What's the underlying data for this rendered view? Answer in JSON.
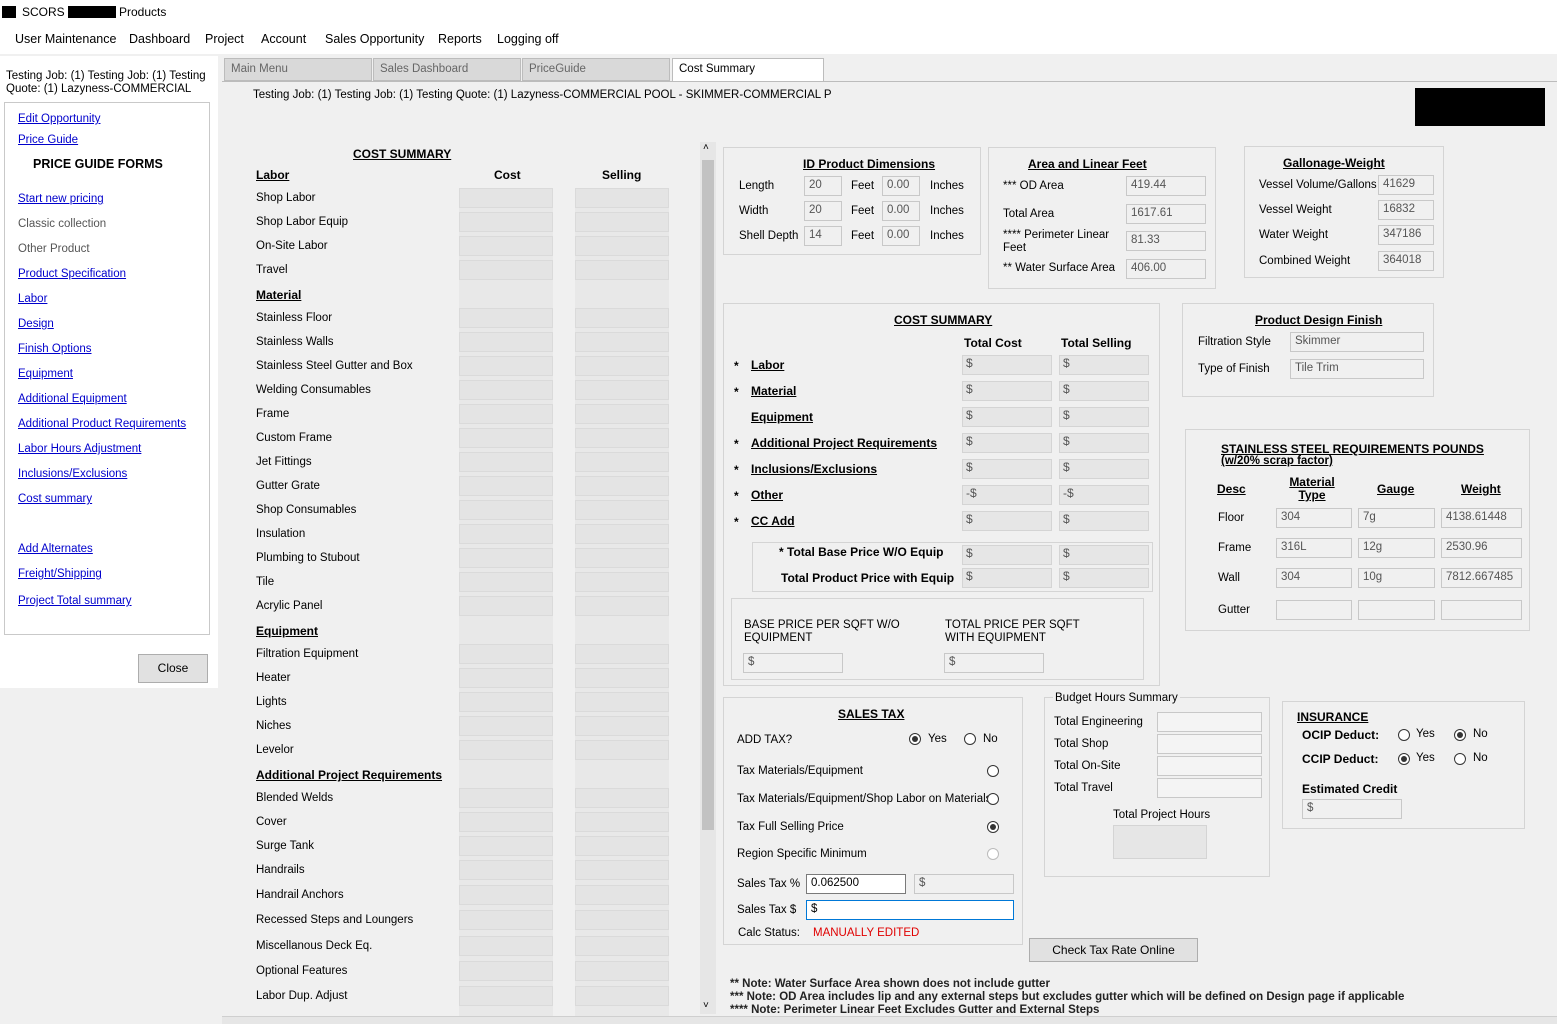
{
  "window": {
    "title_prefix": "SCORS -",
    "title_suffix": "Products"
  },
  "menu": [
    "User Maintenance",
    "Dashboard",
    "Project",
    "Account",
    "Sales Opportunity",
    "Reports",
    "Logging off"
  ],
  "sidebar": {
    "job_info": "Testing Job: (1) Testing Job: (1) Testing Quote: (1) Lazyness-COMMERCIAL",
    "links_top": [
      "Edit Opportunity",
      "Price Guide"
    ],
    "section_title": "PRICE GUIDE FORMS",
    "items": [
      {
        "label": "Start new pricing",
        "link": true
      },
      {
        "label": "Classic collection",
        "link": false
      },
      {
        "label": "Other Product",
        "link": false
      },
      {
        "label": "Product Specification",
        "link": true
      },
      {
        "label": "Labor",
        "link": true
      },
      {
        "label": "Design",
        "link": true
      },
      {
        "label": "Finish Options",
        "link": true
      },
      {
        "label": "Equipment",
        "link": true
      },
      {
        "label": "Additional Equipment",
        "link": true
      },
      {
        "label": "Additional Product Requirements",
        "link": true
      },
      {
        "label": "Labor Hours Adjustment",
        "link": true
      },
      {
        "label": "Inclusions/Exclusions",
        "link": true
      },
      {
        "label": "Cost summary",
        "link": true
      }
    ],
    "items_bottom": [
      "Add Alternates",
      "Freight/Shipping",
      "Project Total summary"
    ],
    "close_label": "Close"
  },
  "tabs": [
    "Main Menu",
    "Sales Dashboard",
    "PriceGuide",
    "Cost Summary"
  ],
  "page_title": "Testing Job: (1) Testing Job: (1) Testing Quote: (1) Lazyness-COMMERCIAL POOL - SKIMMER-COMMERCIAL P",
  "cost_summary": {
    "title": "COST SUMMARY",
    "col_cost": "Cost",
    "col_selling": "Selling",
    "rows": [
      {
        "label": "Labor",
        "header": true
      },
      {
        "label": "Shop Labor"
      },
      {
        "label": "Shop Labor Equip"
      },
      {
        "label": "On-Site Labor"
      },
      {
        "label": "Travel"
      },
      {
        "label": "Material",
        "header": true
      },
      {
        "label": "Stainless Floor"
      },
      {
        "label": "Stainless Walls"
      },
      {
        "label": "Stainless Steel Gutter and Box"
      },
      {
        "label": "Welding Consumables"
      },
      {
        "label": "Frame"
      },
      {
        "label": "Custom Frame"
      },
      {
        "label": "Jet Fittings"
      },
      {
        "label": "Gutter Grate"
      },
      {
        "label": "Shop Consumables"
      },
      {
        "label": "Insulation"
      },
      {
        "label": "Plumbing to Stubout"
      },
      {
        "label": "Tile"
      },
      {
        "label": "Acrylic Panel"
      },
      {
        "label": "Equipment",
        "header": true
      },
      {
        "label": "Filtration Equipment"
      },
      {
        "label": "Heater"
      },
      {
        "label": "Lights"
      },
      {
        "label": "Niches"
      },
      {
        "label": "Levelor"
      },
      {
        "label": "Additional Project Requirements",
        "header": true
      },
      {
        "label": "Blended Welds"
      },
      {
        "label": "Cover"
      },
      {
        "label": "Surge Tank"
      },
      {
        "label": "Handrails"
      },
      {
        "label": "Handrail Anchors"
      },
      {
        "label": "Recessed Steps and Loungers"
      },
      {
        "label": "Miscellanous Deck Eq."
      },
      {
        "label": "Optional Features"
      },
      {
        "label": "Labor Dup. Adjust"
      }
    ]
  },
  "dimensions": {
    "title": "ID Product Dimensions",
    "rows": [
      {
        "label": "Length",
        "feet": "20",
        "feet_unit": "Feet",
        "inches": "0.00",
        "inches_unit": "Inches"
      },
      {
        "label": "Width",
        "feet": "20",
        "feet_unit": "Feet",
        "inches": "0.00",
        "inches_unit": "Inches"
      },
      {
        "label": "Shell Depth",
        "feet": "14",
        "feet_unit": "Feet",
        "inches": "0.00",
        "inches_unit": "Inches"
      }
    ]
  },
  "area": {
    "title": "Area and Linear Feet",
    "od_label": "*** OD Area",
    "od": "419.44",
    "total_label": "Total Area",
    "total": "1617.61",
    "perim_label": "**** Perimeter Linear Feet",
    "perim": "81.33",
    "water_label": "** Water Surface Area",
    "water": "406.00"
  },
  "gallonage": {
    "title": "Gallonage-Weight",
    "rows": [
      {
        "label": "Vessel Volume/Gallons",
        "value": "41629"
      },
      {
        "label": "Vessel Weight",
        "value": "16832"
      },
      {
        "label": "Water Weight",
        "value": "347186"
      },
      {
        "label": "Combined Weight",
        "value": "364018"
      }
    ]
  },
  "totals": {
    "title": "COST SUMMARY",
    "col_cost": "Total Cost",
    "col_selling": "Total Selling",
    "rows": [
      {
        "star": "*",
        "label": "Labor",
        "cost_prefix": "$",
        "sell_prefix": "$"
      },
      {
        "star": "*",
        "label": "Material",
        "cost_prefix": "$",
        "sell_prefix": "$"
      },
      {
        "star": "",
        "label": "Equipment",
        "cost_prefix": "$",
        "sell_prefix": "$"
      },
      {
        "star": "*",
        "label": "Additional Project Requirements",
        "cost_prefix": "$",
        "sell_prefix": "$"
      },
      {
        "star": "*",
        "label": "Inclusions/Exclusions",
        "cost_prefix": "$",
        "sell_prefix": "$"
      },
      {
        "star": "*",
        "label": "Other",
        "cost_prefix": "-$",
        "sell_prefix": "-$"
      },
      {
        "star": "*",
        "label": "CC Add",
        "cost_prefix": "$",
        "sell_prefix": "$"
      }
    ],
    "base_wo_label": "* Total Base Price W/O Equip",
    "with_equip_label": "Total Product Price with Equip",
    "base_sqft_label": "BASE PRICE PER SQFT W/O EQUIPMENT",
    "total_sqft_label": "TOTAL PRICE PER SQFT WITH EQUIPMENT",
    "dollar": "$"
  },
  "finish": {
    "title": "Product Design Finish",
    "filtration_label": "Filtration Style",
    "filtration": "Skimmer",
    "finish_label": "Type of Finish",
    "finish_value": "Tile Trim"
  },
  "stainless": {
    "title": "STAINLESS STEEL REQUIREMENTS POUNDS",
    "subtitle": "(w/20% scrap factor)",
    "cols": [
      "Desc",
      "Material Type",
      "Gauge",
      "Weight"
    ],
    "rows": [
      {
        "desc": "Floor",
        "type": "304",
        "gauge": "7g",
        "weight": "4138.61448"
      },
      {
        "desc": "Frame",
        "type": "316L",
        "gauge": "12g",
        "weight": "2530.96"
      },
      {
        "desc": "Wall",
        "type": "304",
        "gauge": "10g",
        "weight": "7812.667485"
      },
      {
        "desc": "Gutter",
        "type": "",
        "gauge": "",
        "weight": ""
      }
    ]
  },
  "sales_tax": {
    "title": "SALES TAX",
    "add_tax_label": "ADD TAX?",
    "yes": "Yes",
    "no": "No",
    "opt1": "Tax Materials/Equipment",
    "opt2": "Tax Materials/Equipment/Shop Labor on Materials",
    "opt3": "Tax Full Selling Price",
    "opt4": "Region Specific Minimum",
    "pct_label": "Sales Tax %",
    "pct": "0.062500",
    "dollar_label": "Sales Tax $",
    "status_label": "Calc Status:",
    "status": "MANUALLY EDITED",
    "dollar": "$",
    "status_color": "#e00000"
  },
  "budget": {
    "title": "Budget Hours Summary",
    "rows": [
      "Total Engineering",
      "Total Shop",
      "Total On-Site",
      "Total Travel"
    ],
    "project_hours_label": "Total Project Hours",
    "check_button": "Check Tax Rate Online"
  },
  "insurance": {
    "title": "INSURANCE",
    "ocip_label": "OCIP Deduct:",
    "ccip_label": "CCIP Deduct:",
    "yes": "Yes",
    "no": "No",
    "credit_label": "Estimated Credit",
    "dollar": "$"
  },
  "notes": [
    "** Note: Water Surface Area shown does not include gutter",
    "*** Note: OD Area includes lip and any external steps but excludes gutter which will be defined on Design page if applicable",
    "**** Note: Perimeter Linear Feet Excludes Gutter and External Steps"
  ]
}
